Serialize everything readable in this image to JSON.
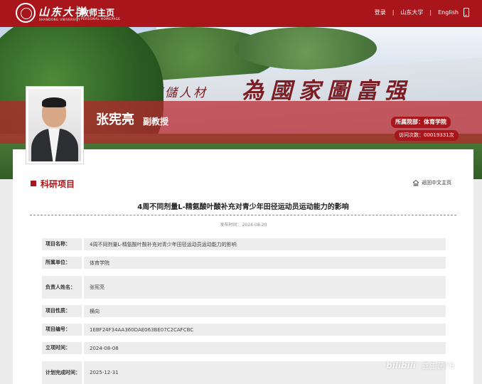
{
  "header": {
    "logo_cn": "山东大学",
    "logo_en": "SHANDONG UNIVERSITY",
    "homepage_title": "教师主页",
    "homepage_sub": "PERSONAL HOMEPAGE",
    "nav": {
      "login": "登录",
      "university": "山东大学",
      "english": "English",
      "sep": "|"
    }
  },
  "banner": {
    "calligraphy_small": "為天下儲人材",
    "calligraphy_big": "為國家圖富强"
  },
  "profile": {
    "name": "张宪亮",
    "title": "副教授",
    "dept_label": "所属院部：",
    "dept_value": "体育学院",
    "visits_label": "访问次数：",
    "visits_value": "00019331次"
  },
  "section": {
    "title": "科研项目",
    "back_link": "返回中文主页"
  },
  "article": {
    "title": "4周不同剂量L-精氨酸叶酸补充对青少年田径运动员运动能力的影响",
    "publish_label": "发布时间：",
    "publish_date": "2024-08-20"
  },
  "details": [
    {
      "label": "项目名称：",
      "value": "4周不同剂量L-精氨酸叶酸补充对青少年田径运动员运动能力的影响"
    },
    {
      "label": "所属单位：",
      "value": "体育学院"
    },
    {
      "label": "负责人姓名：",
      "value": "张宪亮"
    },
    {
      "label": "项目性质：",
      "value": "横向"
    },
    {
      "label": "项目编号：",
      "value": "1EBF24F34AA360DAE063BE07C2CAFCBC"
    },
    {
      "label": "立项时间：",
      "value": "2024-08-08"
    },
    {
      "label": "计划完成时间：",
      "value": "2025-12-31"
    }
  ],
  "watermark": {
    "logo": "bilibili",
    "name": "益生菌FB"
  },
  "colors": {
    "brand_red": "#a8151b"
  },
  "icons": {
    "home": "home-icon",
    "phone": "mobile-phone-icon",
    "seal": "university-seal-icon"
  }
}
